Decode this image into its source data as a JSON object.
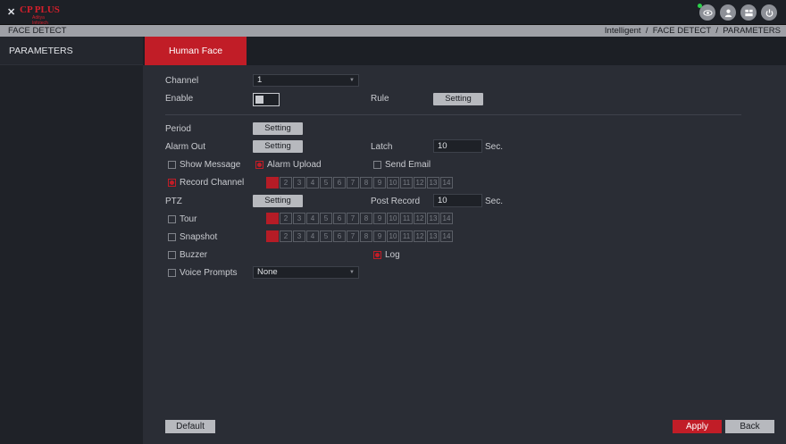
{
  "header": {
    "logo": {
      "mark": "✕",
      "brand": "CP PLUS",
      "sub": "Aditya Infotech"
    },
    "icons": [
      "live-view-icon",
      "user-icon",
      "display-icon",
      "power-icon"
    ],
    "status_dot_color": "#2bd14a"
  },
  "titlebar": {
    "title": "FACE DETECT",
    "breadcrumb": "Intelligent  /  FACE DETECT  /  PARAMETERS"
  },
  "sidebar": {
    "items": [
      {
        "label": "PARAMETERS"
      }
    ]
  },
  "tabs": [
    {
      "label": "Human Face",
      "active": true
    }
  ],
  "form": {
    "channel": {
      "label": "Channel",
      "value": "1"
    },
    "enable": {
      "label": "Enable",
      "on": false
    },
    "rule": {
      "label": "Rule",
      "button": "Setting"
    },
    "period": {
      "label": "Period",
      "button": "Setting"
    },
    "alarm_out": {
      "label": "Alarm Out",
      "button": "Setting"
    },
    "latch": {
      "label": "Latch",
      "value": "10",
      "unit": "Sec."
    },
    "show_message": {
      "label": "Show Message",
      "checked": false
    },
    "alarm_upload": {
      "label": "Alarm Upload",
      "checked": true
    },
    "send_email": {
      "label": "Send Email",
      "checked": false
    },
    "record_channel": {
      "label": "Record Channel",
      "checked": true,
      "selected": [
        1
      ]
    },
    "ptz": {
      "label": "PTZ",
      "button": "Setting"
    },
    "post_record": {
      "label": "Post Record",
      "value": "10",
      "unit": "Sec."
    },
    "tour": {
      "label": "Tour",
      "checked": false,
      "selected": [
        1
      ]
    },
    "snapshot": {
      "label": "Snapshot",
      "checked": false,
      "selected": [
        1
      ]
    },
    "buzzer": {
      "label": "Buzzer",
      "checked": false
    },
    "log": {
      "label": "Log",
      "checked": true
    },
    "voice_prompts": {
      "label": "Voice Prompts",
      "checked": false,
      "value": "None"
    },
    "channels": [
      "1",
      "2",
      "3",
      "4",
      "5",
      "6",
      "7",
      "8",
      "9",
      "10",
      "11",
      "12",
      "13",
      "14"
    ]
  },
  "footer": {
    "default": "Default",
    "apply": "Apply",
    "back": "Back"
  },
  "colors": {
    "accent": "#c11d27",
    "panel": "#2a2d35",
    "sidebar": "#1f2228"
  }
}
